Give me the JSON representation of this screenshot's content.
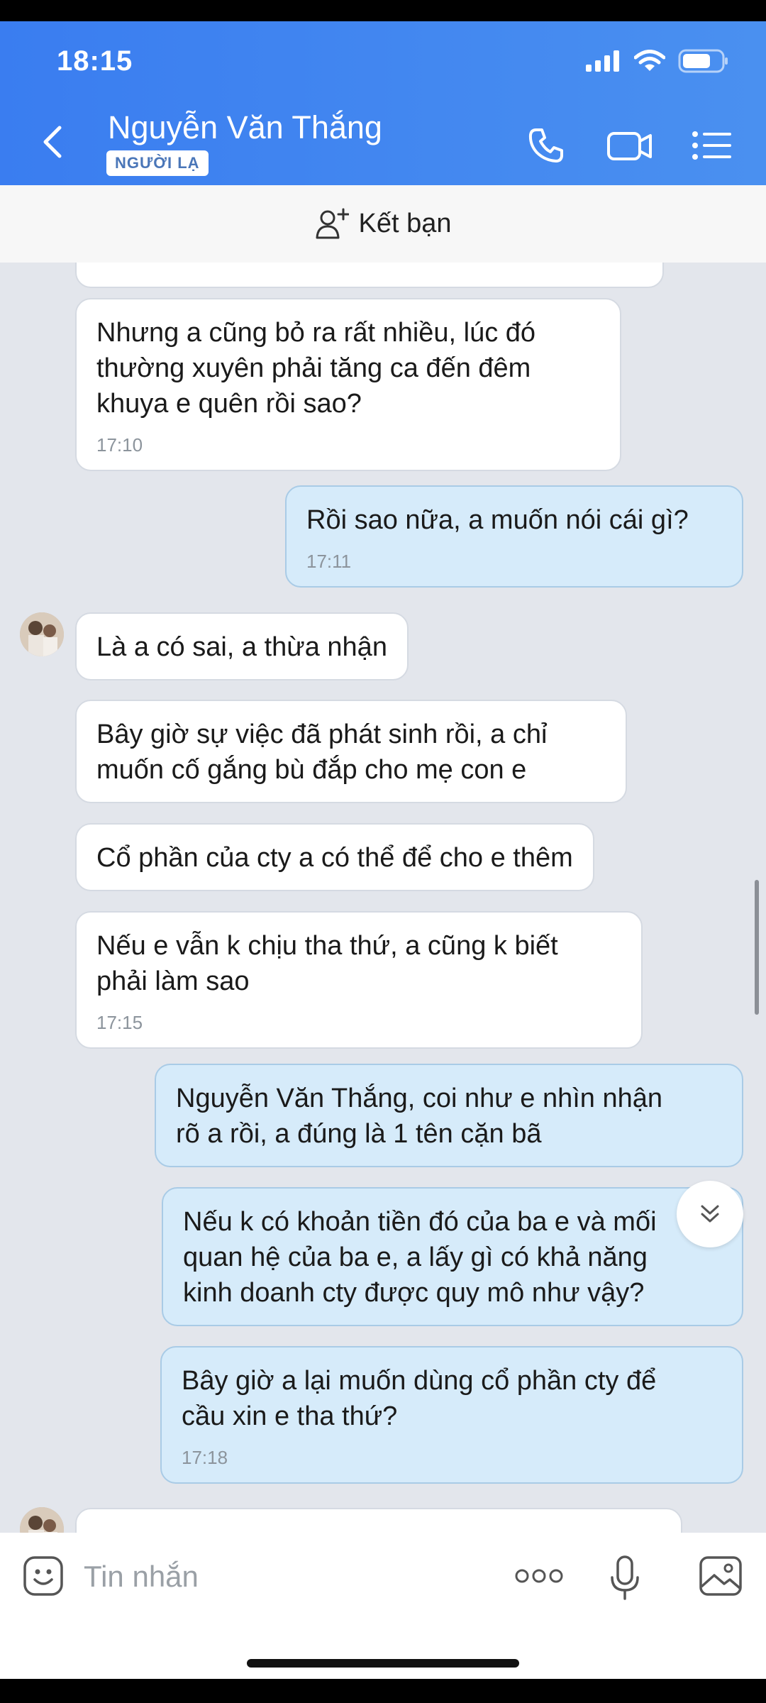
{
  "status_bar": {
    "time": "18:15",
    "icons": [
      "signal-icon",
      "wifi-icon",
      "battery-icon"
    ]
  },
  "header": {
    "contact_name": "Nguyễn Văn Thắng",
    "badge": "NGƯỜI LẠ",
    "buttons": [
      "back-icon",
      "phone-icon",
      "video-call-icon",
      "menu-list-icon"
    ]
  },
  "friend_bar": {
    "label": "Kết bạn",
    "icon": "add-friend-icon"
  },
  "messages": [
    {
      "dir": "in",
      "text": "Nhưng a cũng bỏ ra rất nhiều, lúc đó\nthường xuyên phải tăng ca đến đêm\nkhuya e quên rồi sao?",
      "time": "17:10"
    },
    {
      "dir": "out",
      "text": "Rồi sao nữa, a muốn nói cái gì?",
      "time": "17:11"
    },
    {
      "dir": "in",
      "text": "Là a có sai, a thừa nhận",
      "time": ""
    },
    {
      "dir": "in",
      "text": "Bây giờ sự việc đã phát sinh rồi, a chỉ\nmuốn cố gắng bù đắp cho mẹ con e",
      "time": ""
    },
    {
      "dir": "in",
      "text": "Cổ phần của cty a có thể để cho e thêm",
      "time": ""
    },
    {
      "dir": "in",
      "text": "Nếu e vẫn k chịu tha thứ, a cũng k biết\nphải làm sao",
      "time": "17:15"
    },
    {
      "dir": "out",
      "text": "Nguyễn Văn Thắng, coi như e nhìn nhận\nrõ a rồi, a đúng là 1 tên cặn bã",
      "time": ""
    },
    {
      "dir": "out",
      "text": "Nếu k có khoản tiền đó của ba e và mối\nquan hệ của ba e, a lấy gì có khả năng\nkinh doanh cty được quy mô như vậy?",
      "time": ""
    },
    {
      "dir": "out",
      "text": "Bây giờ a lại muốn dùng cổ phần cty để\ncầu xin e tha thứ?",
      "time": "17:18"
    }
  ],
  "composer": {
    "placeholder": "Tin nhắn",
    "icons": [
      "sticker-icon",
      "more-icon",
      "microphone-icon",
      "image-icon"
    ]
  },
  "colors": {
    "header": "#4a90f0",
    "chat_bg": "#e3e6ec",
    "incoming": "#ffffff",
    "outgoing": "#d6ebfa"
  }
}
